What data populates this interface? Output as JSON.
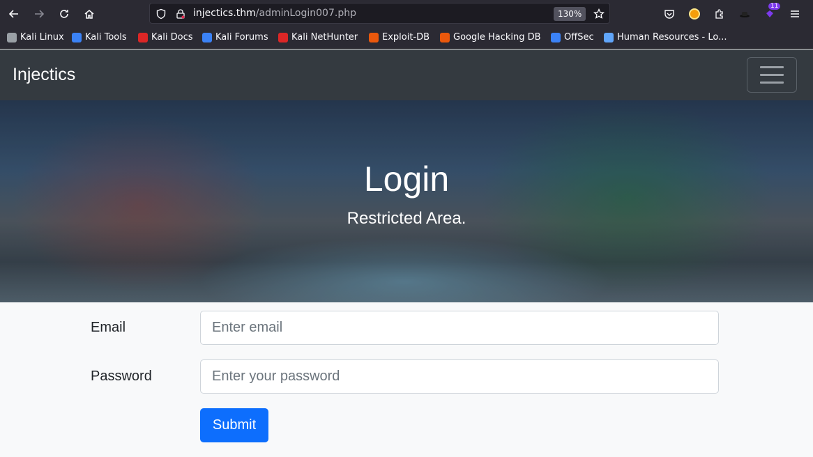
{
  "browser": {
    "url_host": "injectics.thm",
    "url_path": "/adminLogin007.php",
    "zoom": "130%",
    "extension_badge": "11",
    "icons": [
      "back-icon",
      "forward-icon",
      "reload-icon",
      "home-icon",
      "shield-icon",
      "lock-icon",
      "star-icon",
      "pocket-icon",
      "extensions-icon",
      "menu-icon"
    ]
  },
  "bookmarks": [
    {
      "label": "Kali Linux",
      "color": "#9aa0a6"
    },
    {
      "label": "Kali Tools",
      "color": "#3b82f6"
    },
    {
      "label": "Kali Docs",
      "color": "#dc2626"
    },
    {
      "label": "Kali Forums",
      "color": "#3b82f6"
    },
    {
      "label": "Kali NetHunter",
      "color": "#dc2626"
    },
    {
      "label": "Exploit-DB",
      "color": "#ea580c"
    },
    {
      "label": "Google Hacking DB",
      "color": "#ea580c"
    },
    {
      "label": "OffSec",
      "color": "#3b82f6"
    },
    {
      "label": "Human Resources - Lo...",
      "color": "#60a5fa"
    }
  ],
  "navbar": {
    "brand": "Injectics"
  },
  "hero": {
    "title": "Login",
    "subtitle": "Restricted Area."
  },
  "form": {
    "email_label": "Email",
    "email_placeholder": "Enter email",
    "password_label": "Password",
    "password_placeholder": "Enter your password",
    "submit_label": "Submit"
  },
  "colors": {
    "navbar_bg": "#343a40",
    "primary_button": "#0d6efd",
    "page_bg": "#f8f9fa"
  }
}
